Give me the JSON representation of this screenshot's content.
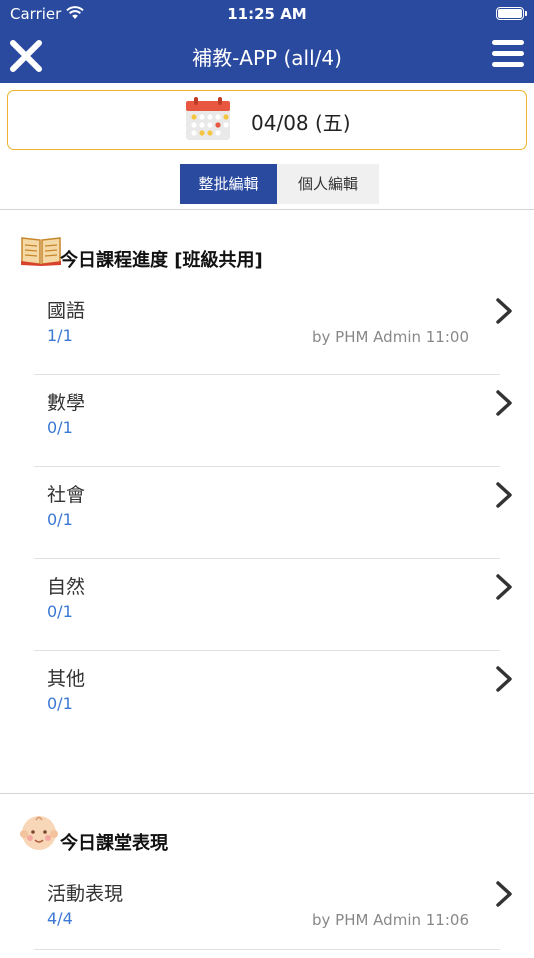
{
  "status_bar": {
    "carrier": "Carrier",
    "time": "11:25 AM"
  },
  "header": {
    "title": "補教-APP (all/4)"
  },
  "date": {
    "text": "04/08 (五)"
  },
  "segments": {
    "batch_edit": "整批編輯",
    "individual_edit": "個人編輯"
  },
  "progress_section": {
    "title": "今日課程進度 [班級共用]",
    "rows": [
      {
        "label": "國語",
        "count": "1/1",
        "meta": "by PHM Admin 11:00"
      },
      {
        "label": "數學",
        "count": "0/1",
        "meta": ""
      },
      {
        "label": "社會",
        "count": "0/1",
        "meta": ""
      },
      {
        "label": "自然",
        "count": "0/1",
        "meta": ""
      },
      {
        "label": "其他",
        "count": "0/1",
        "meta": ""
      }
    ]
  },
  "performance_section": {
    "title": "今日課堂表現",
    "rows": [
      {
        "label": "活動表現",
        "count": "4/4",
        "meta": "by PHM Admin 11:06"
      }
    ]
  },
  "colors": {
    "header": "#2a4a9f",
    "accent_border": "#f0b22e",
    "count_text": "#3b78d4"
  }
}
